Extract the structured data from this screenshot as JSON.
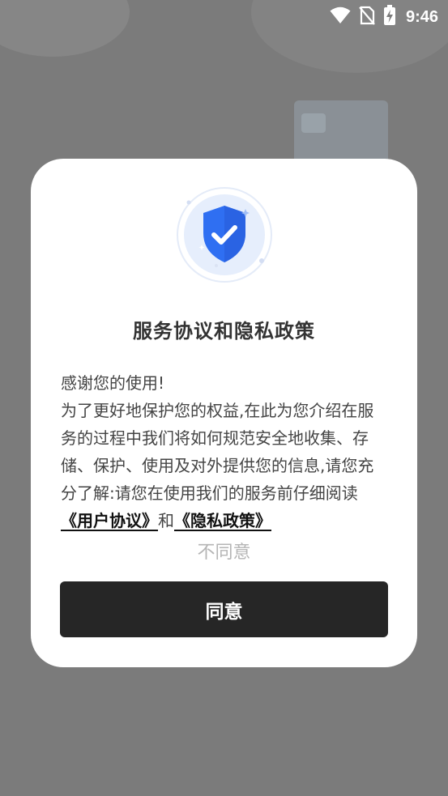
{
  "status_bar": {
    "time": "9:46",
    "icons": [
      "wifi-icon",
      "no-sim-icon",
      "battery-charging-icon"
    ]
  },
  "dialog": {
    "title": "服务协议和隐私政策",
    "greeting": "感谢您的使用!",
    "body_text": "为了更好地保护您的权益,在此为您介绍在服务的过程中我们将如何规范安全地收集、存储、保护、使用及对外提供您的信息,请您充分了解:请您在使用我们的服务前仔细阅读",
    "user_agreement_link": "《用户协议》",
    "conjunction": "和",
    "privacy_policy_link": "《隐私政策》",
    "disagree_label": "不同意",
    "agree_label": "同意"
  },
  "colors": {
    "overlay_background": "#7b7b7b",
    "dialog_background": "#ffffff",
    "primary_button": "#262626",
    "shield_blue": "#2f6ff2",
    "disagree_text": "#b5b5b5"
  }
}
